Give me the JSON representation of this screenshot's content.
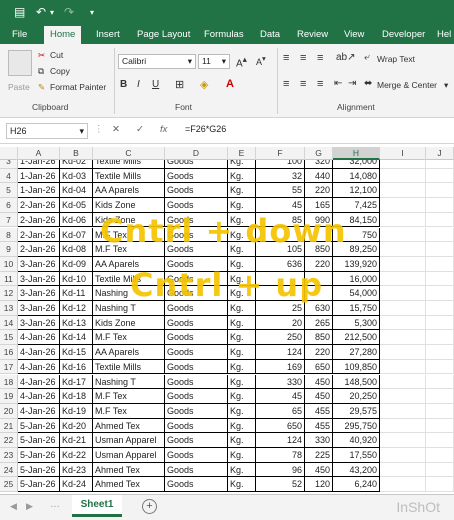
{
  "ribbon_tabs": [
    "File",
    "Home",
    "Insert",
    "Page Layout",
    "Formulas",
    "Data",
    "Review",
    "View",
    "Developer",
    "Hel"
  ],
  "clipboard": {
    "paste": "Paste",
    "cut": "Cut",
    "copy": "Copy",
    "format_painter": "Format Painter",
    "group": "Clipboard"
  },
  "font": {
    "name": "Calibri",
    "size": "11",
    "group": "Font"
  },
  "alignment": {
    "wrap": "Wrap Text",
    "merge": "Merge & Center",
    "group": "Alignment"
  },
  "formula_bar": {
    "name_box": "H26",
    "formula": "=F26*G26"
  },
  "columns": [
    "A",
    "B",
    "C",
    "D",
    "E",
    "F",
    "G",
    "H",
    "I",
    "J"
  ],
  "rows": [
    {
      "n": "3",
      "a": "1-Jan-26",
      "b": "Kd-02",
      "c": "Textile Mills",
      "d": "Goods",
      "e": "Kg.",
      "f": "100",
      "g": "320",
      "h": "32,000"
    },
    {
      "n": "4",
      "a": "1-Jan-26",
      "b": "Kd-03",
      "c": "Textile Mills",
      "d": "Goods",
      "e": "Kg.",
      "f": "32",
      "g": "440",
      "h": "14,080"
    },
    {
      "n": "5",
      "a": "1-Jan-26",
      "b": "Kd-04",
      "c": "AA Aparels",
      "d": "Goods",
      "e": "Kg.",
      "f": "55",
      "g": "220",
      "h": "12,100"
    },
    {
      "n": "6",
      "a": "2-Jan-26",
      "b": "Kd-05",
      "c": "Kids Zone",
      "d": "Goods",
      "e": "Kg.",
      "f": "45",
      "g": "165",
      "h": "7,425"
    },
    {
      "n": "7",
      "a": "2-Jan-26",
      "b": "Kd-06",
      "c": "Kids Zone",
      "d": "Goods",
      "e": "Kg.",
      "f": "85",
      "g": "990",
      "h": "84,150"
    },
    {
      "n": "8",
      "a": "2-Jan-26",
      "b": "Kd-07",
      "c": "M.F Tex",
      "d": "Goods",
      "e": "Kg.",
      "f": "",
      "g": "",
      "h": "750"
    },
    {
      "n": "9",
      "a": "2-Jan-26",
      "b": "Kd-08",
      "c": "M.F Tex",
      "d": "Goods",
      "e": "Kg.",
      "f": "105",
      "g": "850",
      "h": "89,250"
    },
    {
      "n": "10",
      "a": "3-Jan-26",
      "b": "Kd-09",
      "c": "AA Aparels",
      "d": "Goods",
      "e": "Kg.",
      "f": "636",
      "g": "220",
      "h": "139,920"
    },
    {
      "n": "11",
      "a": "3-Jan-26",
      "b": "Kd-10",
      "c": "Textile Mills",
      "d": "Goods",
      "e": "Kg.",
      "f": "",
      "g": "",
      "h": "16,000"
    },
    {
      "n": "12",
      "a": "3-Jan-26",
      "b": "Kd-11",
      "c": "Nashing",
      "d": "Goods",
      "e": "Kg.",
      "f": "",
      "g": "",
      "h": "54,000"
    },
    {
      "n": "13",
      "a": "3-Jan-26",
      "b": "Kd-12",
      "c": "Nashing T",
      "d": "Goods",
      "e": "Kg.",
      "f": "25",
      "g": "630",
      "h": "15,750"
    },
    {
      "n": "14",
      "a": "3-Jan-26",
      "b": "Kd-13",
      "c": "Kids Zone",
      "d": "Goods",
      "e": "Kg.",
      "f": "20",
      "g": "265",
      "h": "5,300"
    },
    {
      "n": "15",
      "a": "4-Jan-26",
      "b": "Kd-14",
      "c": "M.F Tex",
      "d": "Goods",
      "e": "Kg.",
      "f": "250",
      "g": "850",
      "h": "212,500"
    },
    {
      "n": "16",
      "a": "4-Jan-26",
      "b": "Kd-15",
      "c": "AA Aparels",
      "d": "Goods",
      "e": "Kg.",
      "f": "124",
      "g": "220",
      "h": "27,280"
    },
    {
      "n": "17",
      "a": "4-Jan-26",
      "b": "Kd-16",
      "c": "Textile Mills",
      "d": "Goods",
      "e": "Kg.",
      "f": "169",
      "g": "650",
      "h": "109,850"
    },
    {
      "n": "18",
      "a": "4-Jan-26",
      "b": "Kd-17",
      "c": "Nashing T",
      "d": "Goods",
      "e": "Kg.",
      "f": "330",
      "g": "450",
      "h": "148,500"
    },
    {
      "n": "19",
      "a": "4-Jan-26",
      "b": "Kd-18",
      "c": "M.F Tex",
      "d": "Goods",
      "e": "Kg.",
      "f": "45",
      "g": "450",
      "h": "20,250"
    },
    {
      "n": "20",
      "a": "4-Jan-26",
      "b": "Kd-19",
      "c": "M.F Tex",
      "d": "Goods",
      "e": "Kg.",
      "f": "65",
      "g": "455",
      "h": "29,575"
    },
    {
      "n": "21",
      "a": "5-Jan-26",
      "b": "Kd-20",
      "c": "Ahmed Tex",
      "d": "Goods",
      "e": "Kg.",
      "f": "650",
      "g": "455",
      "h": "295,750"
    },
    {
      "n": "22",
      "a": "5-Jan-26",
      "b": "Kd-21",
      "c": "Usman Apparel",
      "d": "Goods",
      "e": "Kg.",
      "f": "124",
      "g": "330",
      "h": "40,920"
    },
    {
      "n": "23",
      "a": "5-Jan-26",
      "b": "Kd-22",
      "c": "Usman Apparel",
      "d": "Goods",
      "e": "Kg.",
      "f": "78",
      "g": "225",
      "h": "17,550"
    },
    {
      "n": "24",
      "a": "5-Jan-26",
      "b": "Kd-23",
      "c": "Ahmed Tex",
      "d": "Goods",
      "e": "Kg.",
      "f": "96",
      "g": "450",
      "h": "43,200"
    },
    {
      "n": "25",
      "a": "5-Jan-26",
      "b": "Kd-24",
      "c": "Ahmed Tex",
      "d": "Goods",
      "e": "Kg.",
      "f": "52",
      "g": "120",
      "h": "6,240"
    }
  ],
  "overlay": {
    "line1": "Cntrl + down",
    "line2": "Cntrl + up"
  },
  "sheet": {
    "tab": "Sheet1",
    "add": "+"
  },
  "watermark": "InShOt"
}
